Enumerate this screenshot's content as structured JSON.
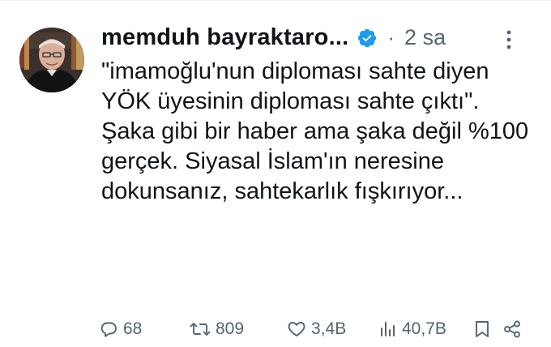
{
  "tweet": {
    "author": {
      "name": "memduh bayraktaro...",
      "verified": true,
      "avatar_icon": "avatar-photo"
    },
    "separator": "·",
    "timestamp": "2 sa",
    "text_paragraphs": [
      "\"imamoğlu'nun diploması sahte diyen YÖK üyesinin diploması sahte çıktı\".",
      "Şaka gibi bir haber ama şaka değil %100 gerçek. Siyasal İslam'ın neresine dokunsanız, sahtekarlık fışkırıyor..."
    ],
    "actions": {
      "replies": "68",
      "reposts": "809",
      "likes": "3,4B",
      "views": "40,7B"
    },
    "icons": {
      "reply": "reply-icon",
      "repost": "repost-icon",
      "like": "heart-icon",
      "views": "views-icon",
      "bookmark": "bookmark-icon",
      "share": "share-icon",
      "more": "more-icon",
      "verified": "verified-badge-icon"
    }
  },
  "colors": {
    "text": "#0f1419",
    "secondary": "#536471",
    "verified": "#1d9bf0",
    "border": "#eff3f4"
  }
}
